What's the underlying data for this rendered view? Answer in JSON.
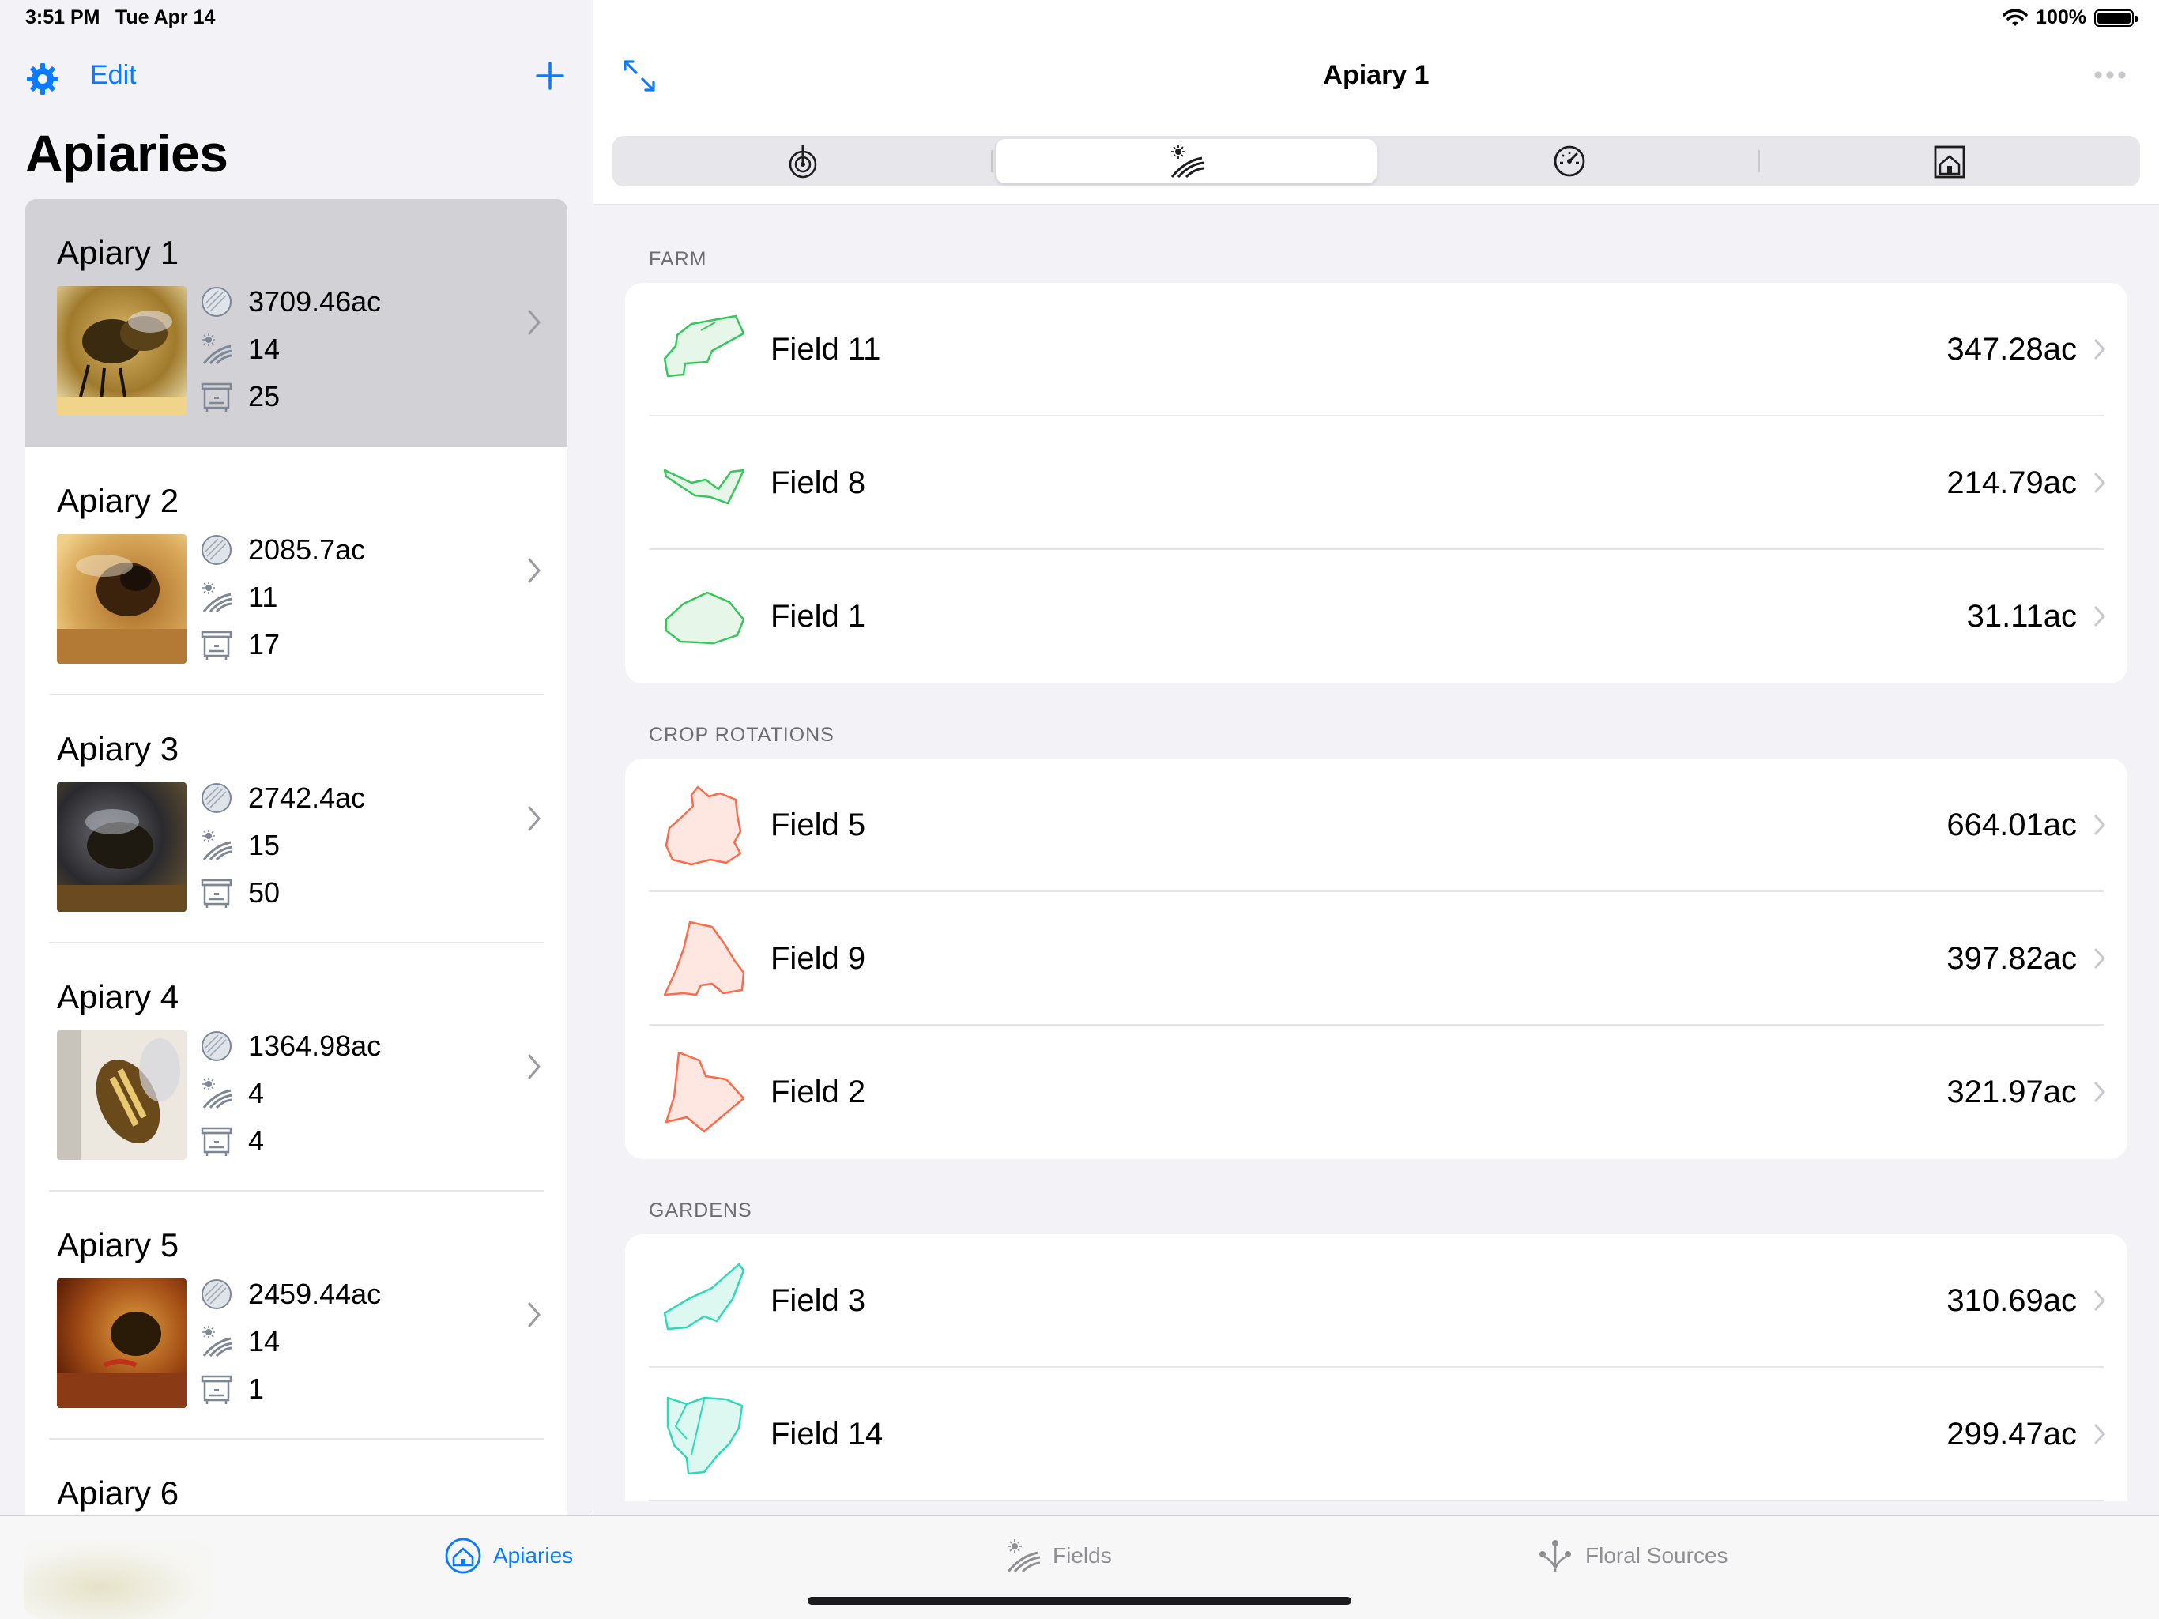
{
  "status": {
    "time": "3:51 PM",
    "date": "Tue Apr 14",
    "battery": "100%"
  },
  "sidebar": {
    "edit_label": "Edit",
    "title": "Apiaries",
    "apiaries": [
      {
        "name": "Apiary 1",
        "area": "3709.46ac",
        "fields": "14",
        "hives": "25",
        "selected": true
      },
      {
        "name": "Apiary 2",
        "area": "2085.7ac",
        "fields": "11",
        "hives": "17"
      },
      {
        "name": "Apiary 3",
        "area": "2742.4ac",
        "fields": "15",
        "hives": "50"
      },
      {
        "name": "Apiary 4",
        "area": "1364.98ac",
        "fields": "4",
        "hives": "4"
      },
      {
        "name": "Apiary 5",
        "area": "2459.44ac",
        "fields": "14",
        "hives": "1"
      },
      {
        "name": "Apiary 6"
      }
    ]
  },
  "detail": {
    "title": "Apiary 1",
    "segments": [
      "radar-icon",
      "field-icon",
      "gauge-icon",
      "hive-house-icon"
    ],
    "active_segment": 1,
    "sections": [
      {
        "title": "FARM",
        "color": "#34c759",
        "fill": "#e6f6e8",
        "fields": [
          {
            "name": "Field 11",
            "area": "347.28ac"
          },
          {
            "name": "Field 8",
            "area": "214.79ac"
          },
          {
            "name": "Field 1",
            "area": "31.11ac"
          }
        ]
      },
      {
        "title": "CROP ROTATIONS",
        "color": "#ff6b4a",
        "fill": "#ffe7e1",
        "fields": [
          {
            "name": "Field 5",
            "area": "664.01ac"
          },
          {
            "name": "Field 9",
            "area": "397.82ac"
          },
          {
            "name": "Field 2",
            "area": "321.97ac"
          }
        ]
      },
      {
        "title": "GARDENS",
        "color": "#2ed9b5",
        "fill": "#dcf8f1",
        "fields": [
          {
            "name": "Field 3",
            "area": "310.69ac"
          },
          {
            "name": "Field 14",
            "area": "299.47ac"
          }
        ]
      }
    ]
  },
  "tabs": {
    "apiaries": "Apiaries",
    "fields": "Fields",
    "floral": "Floral Sources"
  },
  "colors": {
    "accent": "#0a7aff",
    "selected_bg": "#d1d1d6"
  }
}
